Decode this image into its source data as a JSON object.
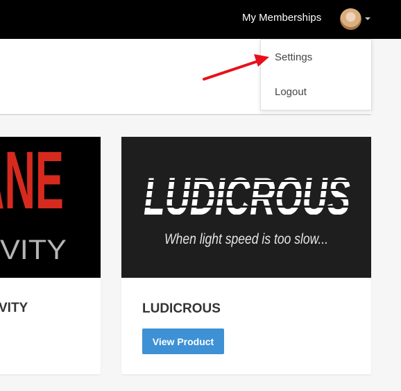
{
  "header": {
    "nav_link": "My Memberships",
    "avatar_icon": "user-avatar"
  },
  "dropdown": {
    "items": [
      {
        "label": "Settings"
      },
      {
        "label": "Logout"
      }
    ]
  },
  "annotation": {
    "arrow_color": "#e8101b"
  },
  "products": [
    {
      "title": "VITY",
      "image_text_top": "ANE",
      "image_text_bottom": "IVITY"
    },
    {
      "title": "LUDICROUS",
      "image_logo": "LUDICROUS",
      "image_tagline": "When light speed is too slow...",
      "button_label": "View Product"
    }
  ],
  "colors": {
    "topbar": "#000000",
    "button": "#3e91d4",
    "page_bg": "#f6f6f6"
  }
}
